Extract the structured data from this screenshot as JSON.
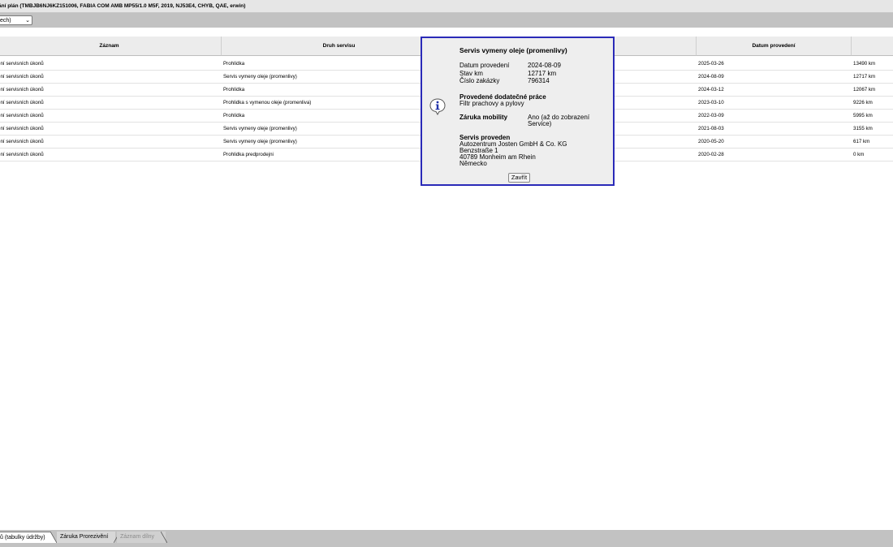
{
  "window": {
    "title": "ání plán (TMBJB6NJ6KZ151006, FABIA COM AMB MP55/1.0 M5F, 2019, NJ53E4, CHYB, QAE, erwin)"
  },
  "filter": {
    "selected": "ech)"
  },
  "table": {
    "headers": {
      "zaznam": "Záznam",
      "druh": "Druh servisu",
      "hidden": "",
      "datum": "Datum provedení",
      "km": ""
    },
    "rows": [
      {
        "zaznam": "ení servisních úkonů",
        "druh": "Prohlídka",
        "datum": "2025-03-26",
        "km": "13490 km"
      },
      {
        "zaznam": "ení servisních úkonů",
        "druh": "Servis vymeny oleje (promenlivy)",
        "datum": "2024-08-09",
        "km": "12717 km"
      },
      {
        "zaznam": "ení servisních úkonů",
        "druh": "Prohlídka",
        "datum": "2024-03-12",
        "km": "12067 km"
      },
      {
        "zaznam": "ení servisních úkonů",
        "druh": "Prohlidka s vymenou oleje (promenliva)",
        "datum": "2023-03-10",
        "km": "9226 km"
      },
      {
        "zaznam": "ení servisních úkonů",
        "druh": "Prohlídka",
        "datum": "2022-03-09",
        "km": "5995 km"
      },
      {
        "zaznam": "ení servisních úkonů",
        "druh": "Servis vymeny oleje (promenlivy)",
        "datum": "2021-08-03",
        "km": "3155 km"
      },
      {
        "zaznam": "ení servisních úkonů",
        "druh": "Servis vymeny oleje (promenlivy)",
        "datum": "2020-05-20",
        "km": "617 km"
      },
      {
        "zaznam": "ení servisních úkonů",
        "druh": "Prohlidka predprodejni",
        "datum": "2020-02-28",
        "km": "0 km"
      }
    ]
  },
  "popup": {
    "title": "Servis vymeny oleje (promenlivy)",
    "datum_label": "Datum provedení",
    "datum_value": "2024-08-09",
    "km_label": "Stav km",
    "km_value": "12717 km",
    "zakazka_label": "Číslo zakázky",
    "zakazka_value": "796314",
    "extra_heading": "Provedené dodatečné práce",
    "extra_text": "Filtr prachovy a pylovy",
    "mobility_label": "Záruka mobility",
    "mobility_value_1": "Ano (až do zobrazení",
    "mobility_value_2": "Service)",
    "service_heading": "Servis proveden",
    "service_line_1": "Autozentrum Josten GmbH & Co. KG",
    "service_line_2": "Benzstraße 1",
    "service_line_3": "40789 Monheim am Rhein",
    "service_line_4": "Německo",
    "close_label": "Zavřít",
    "icon": "info-icon",
    "border_color": "#2a2ab8"
  },
  "tabs": [
    {
      "label": "ů (tabulky údržby)"
    },
    {
      "label": "Záruka Prorezivění"
    },
    {
      "label": "Záznam dílny"
    }
  ]
}
